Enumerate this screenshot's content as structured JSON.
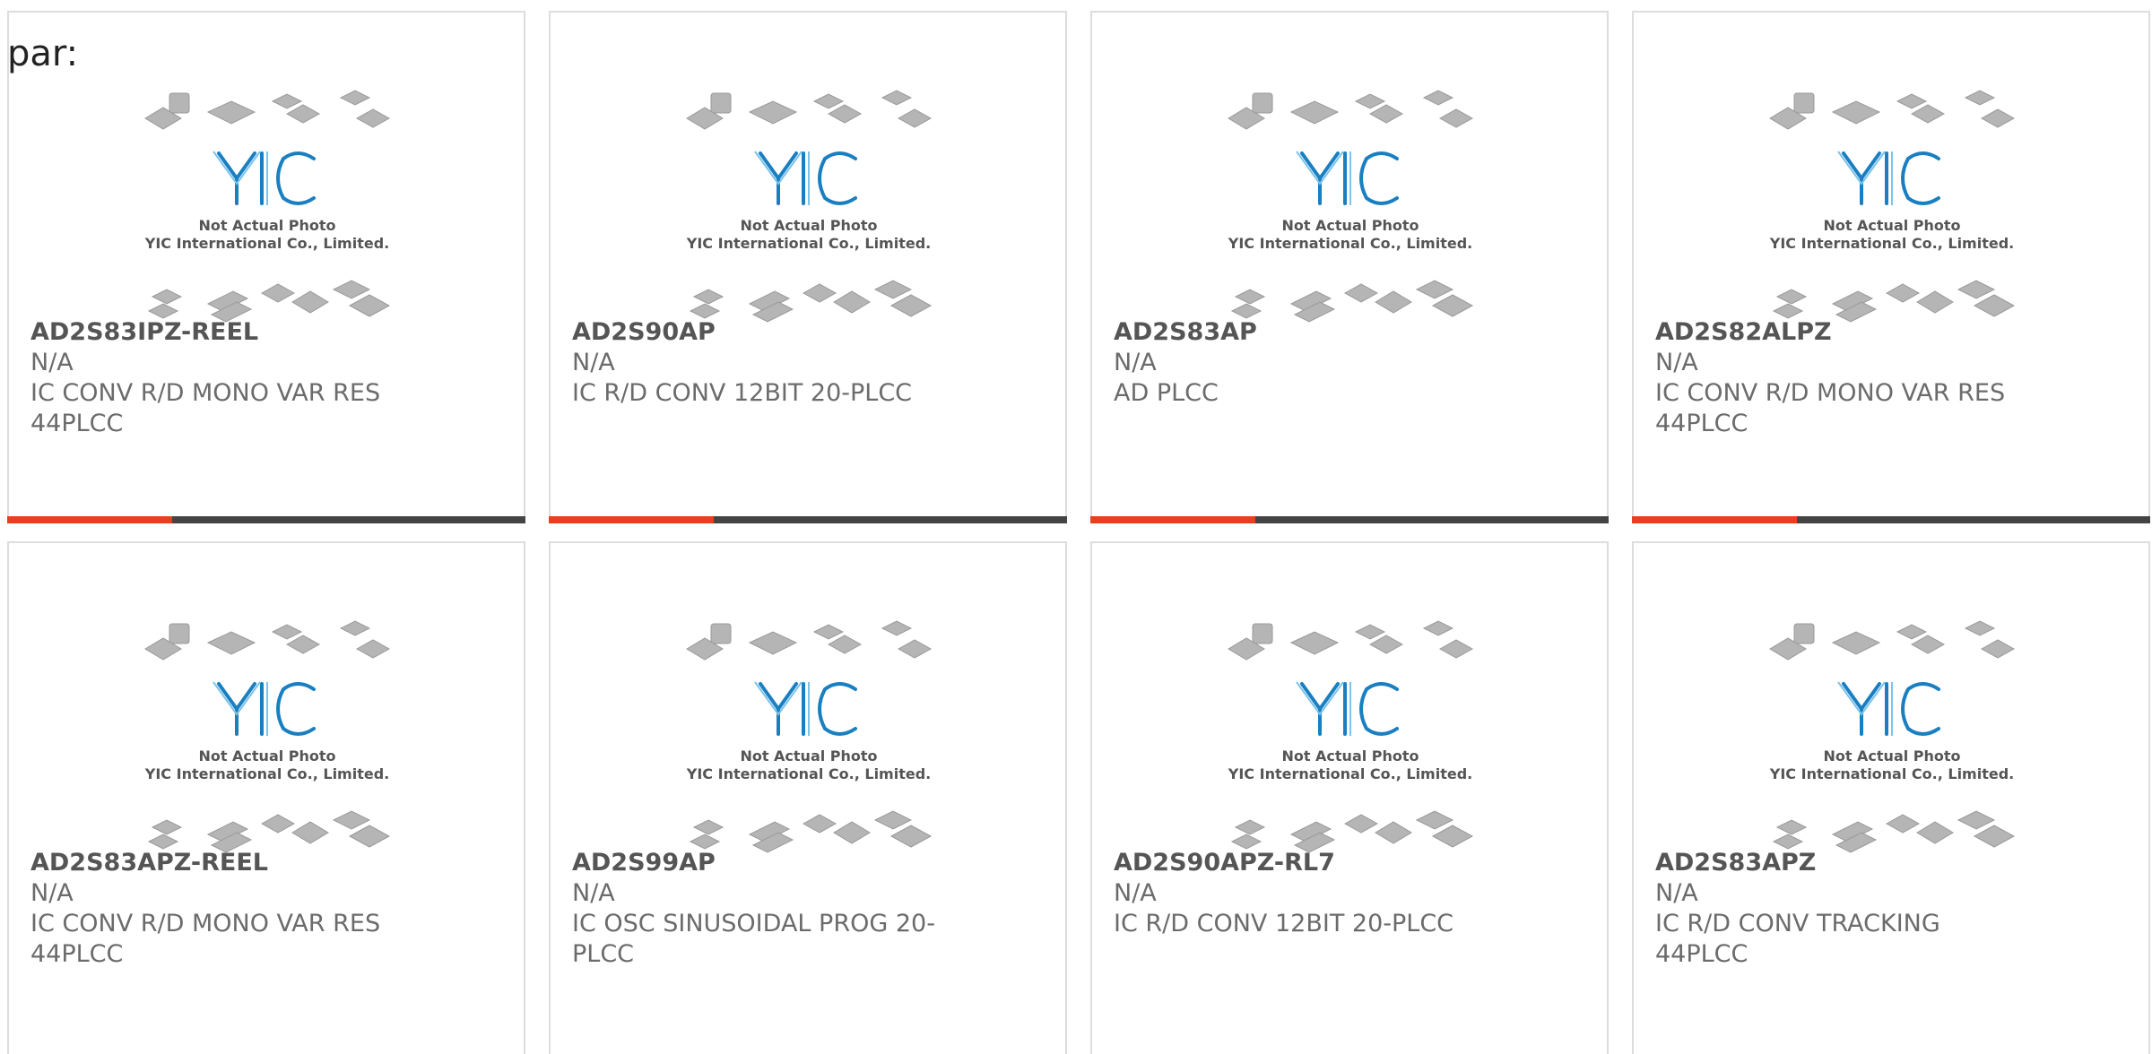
{
  "prefix_text": "par:",
  "placeholder": {
    "line1": "Not Actual Photo",
    "line2": "YIC International Co., Limited.",
    "logo": "YIC",
    "brand_color": "#1a7fc1"
  },
  "colors": {
    "accent": "#e8401c",
    "bar": "#444444"
  },
  "products": [
    {
      "part": "AD2S83IPZ-REEL",
      "stock": "N/A",
      "desc": "IC CONV R/D MONO VAR RES 44PLCC"
    },
    {
      "part": "AD2S90AP",
      "stock": "N/A",
      "desc": "IC R/D CONV 12BIT 20-PLCC"
    },
    {
      "part": "AD2S83AP",
      "stock": "N/A",
      "desc": "AD PLCC"
    },
    {
      "part": "AD2S82ALPZ",
      "stock": "N/A",
      "desc": "IC CONV R/D MONO VAR RES 44PLCC"
    },
    {
      "part": "AD2S83APZ-REEL",
      "stock": "N/A",
      "desc": "IC CONV R/D MONO VAR RES 44PLCC"
    },
    {
      "part": "AD2S99AP",
      "stock": "N/A",
      "desc": "IC OSC SINUSOIDAL PROG 20-PLCC"
    },
    {
      "part": "AD2S90APZ-RL7",
      "stock": "N/A",
      "desc": "IC R/D CONV 12BIT 20-PLCC"
    },
    {
      "part": "AD2S83APZ",
      "stock": "N/A",
      "desc": "IC R/D CONV TRACKING 44PLCC"
    }
  ]
}
